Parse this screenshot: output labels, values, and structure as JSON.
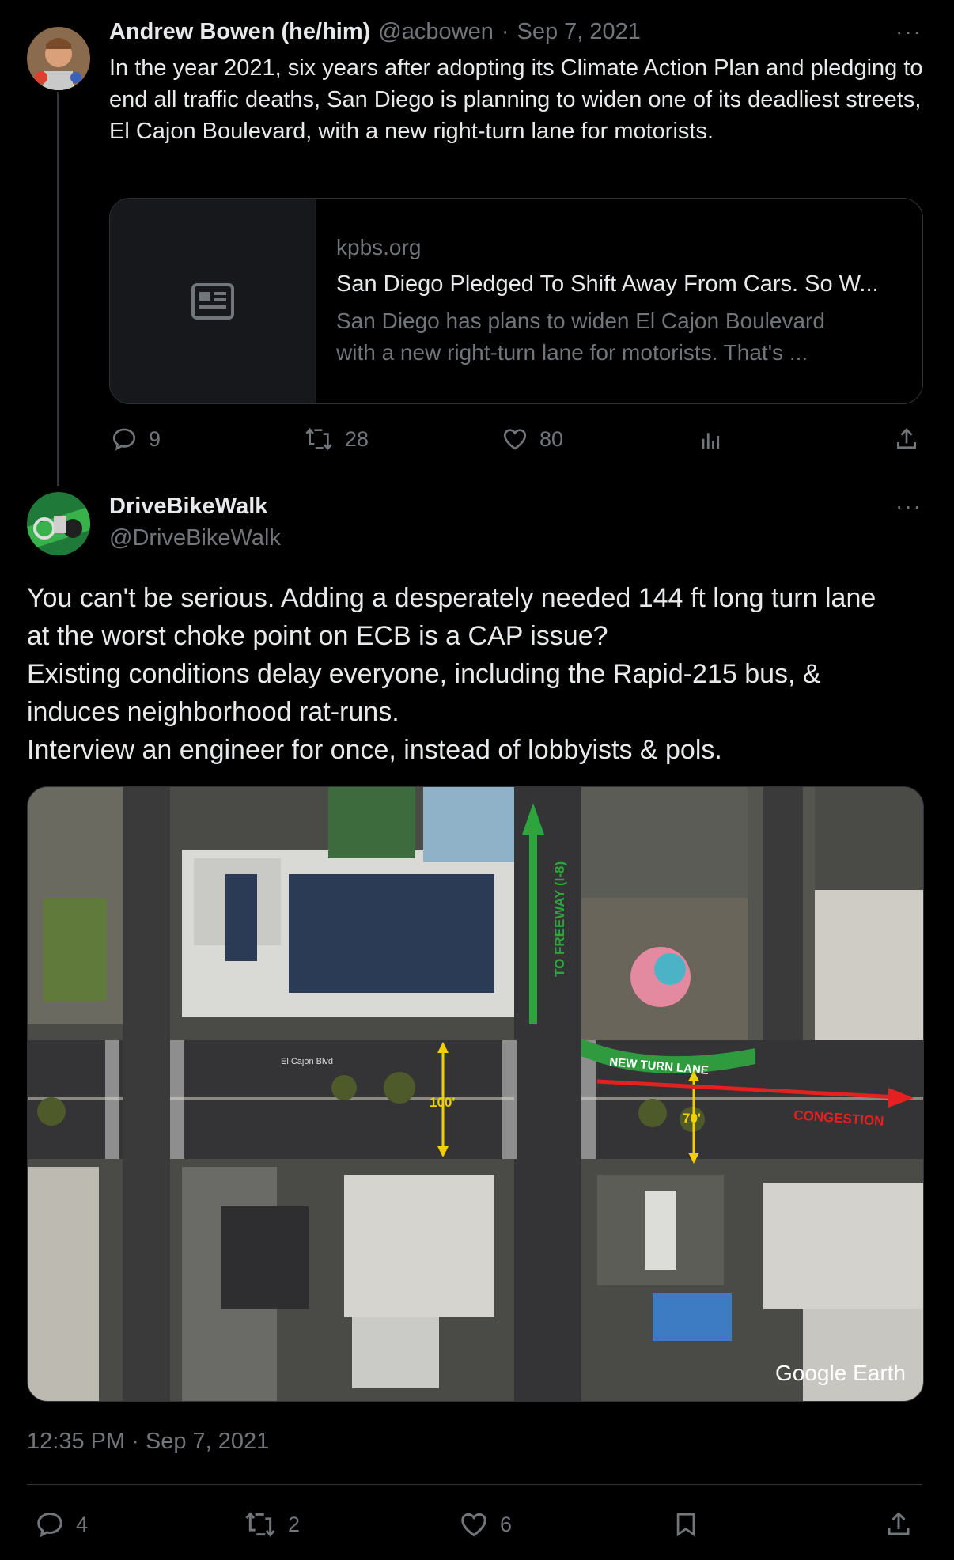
{
  "parent_tweet": {
    "author_name": "Andrew Bowen (he/him)",
    "handle": "@acbowen",
    "separator": "·",
    "date": "Sep 7, 2021",
    "more": "···",
    "text": "In the year 2021, six years after adopting its Climate Action Plan and pledging to end all traffic deaths, San Diego is planning to widen one of its deadliest streets, El Cajon Boulevard, with a new right-turn lane for motorists.",
    "link_card": {
      "domain": "kpbs.org",
      "title": "San Diego Pledged To Shift Away From Cars. So W...",
      "description_line1": "San Diego has plans to widen El Cajon Boulevard",
      "description_line2": "with a new right-turn lane for motorists. That's ..."
    },
    "actions": {
      "replies": "9",
      "retweets": "28",
      "likes": "80"
    }
  },
  "main_tweet": {
    "author_name": "DriveBikeWalk",
    "handle": "@DriveBikeWalk",
    "more": "···",
    "lines": [
      "You can't be serious. Adding a desperately needed 144 ft long turn lane",
      "at the worst choke point on ECB is a CAP issue?",
      "Existing conditions delay everyone, including the Rapid-215 bus, &",
      "induces neighborhood rat-runs.",
      "Interview an engineer for once, instead of lobbyists & pols."
    ],
    "image": {
      "label_new_turn_lane": "NEW TURN LANE",
      "label_to_freeway": "TO FREEWAY (I-8)",
      "label_100": "100'",
      "label_70": "70'",
      "label_congestion": "CONGESTION",
      "label_street": "El Cajon Blvd",
      "watermark": "Google Earth"
    },
    "timestamp": "12:35 PM · Sep 7, 2021",
    "actions": {
      "replies": "4",
      "retweets": "2",
      "likes": "6"
    }
  },
  "colors": {
    "background": "#000000",
    "text": "#e7e9ea",
    "muted": "#71767b",
    "border": "#2f3336"
  }
}
